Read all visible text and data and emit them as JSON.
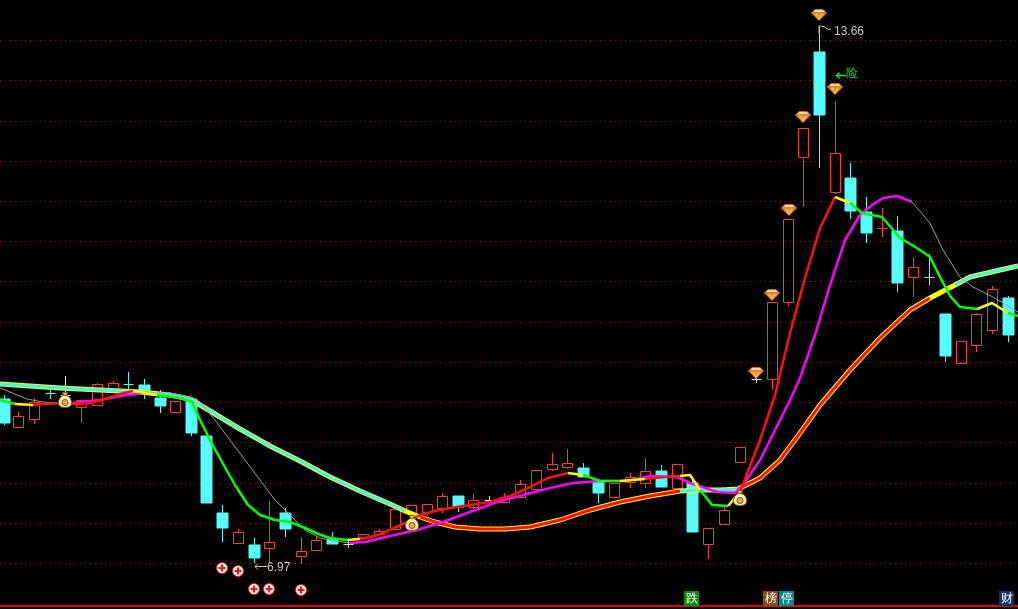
{
  "chart": {
    "high_label": "13.66",
    "low_label": "6.97",
    "signal_label": "险"
  },
  "tags": [
    {
      "text": "跌",
      "color": "#108a10"
    },
    {
      "text": "榜",
      "color": "#8a4a10"
    },
    {
      "text": "停",
      "color": "#0a8a8a"
    },
    {
      "text": "财",
      "color": "#0a3a6a"
    }
  ]
}
